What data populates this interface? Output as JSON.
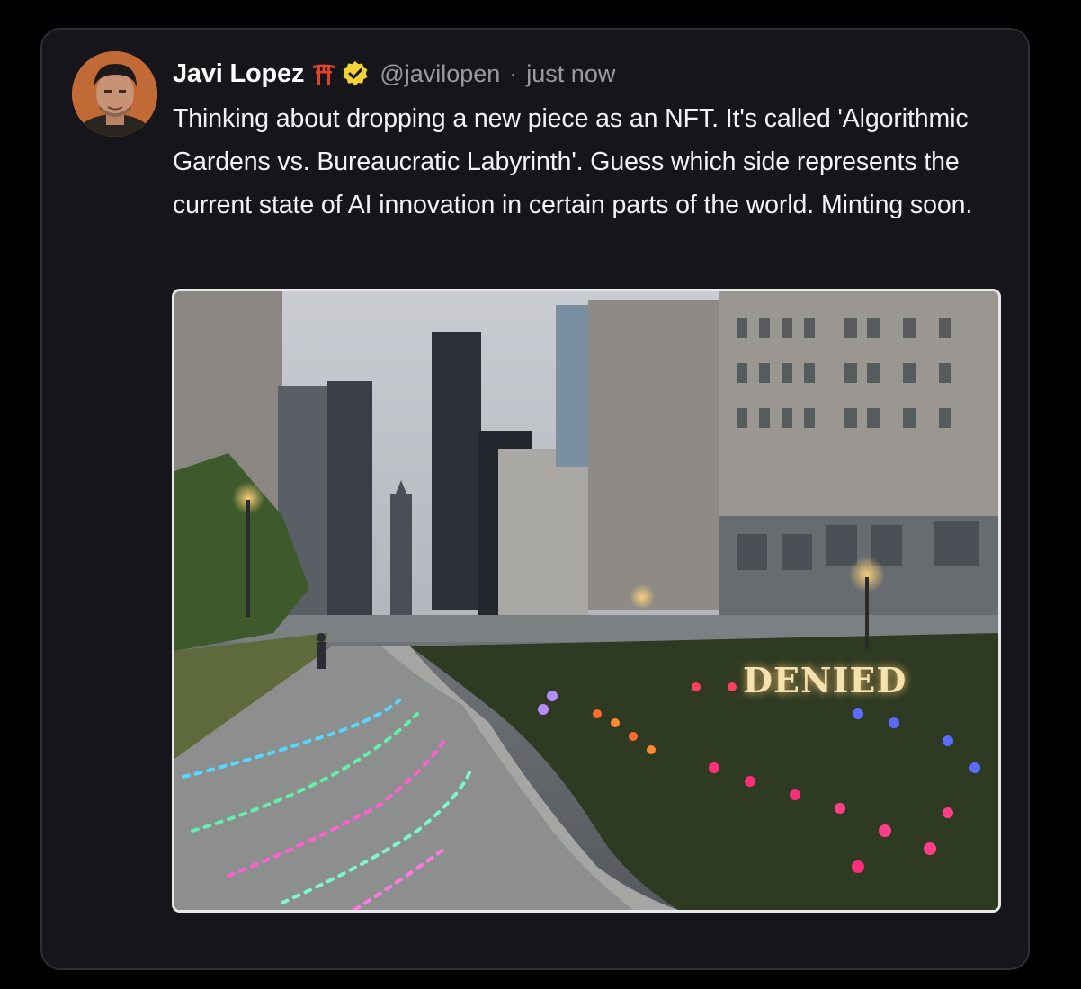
{
  "post": {
    "author": {
      "name": "Javi Lopez",
      "handle": "@javilopen",
      "name_emoji_icon": "torii-gate-icon",
      "verified_icon": "verified-badge-icon"
    },
    "separator": "·",
    "timestamp": "just now",
    "text": "Thinking about dropping a new piece as an NFT. It's called 'Algorithmic Gardens vs. Bureaucratic Labyrinth'. Guess which side represents the current state of AI innovation in certain parts of the world. Minting soon.",
    "media": {
      "sign_text": "DENIED"
    }
  },
  "colors": {
    "background": "#000000",
    "card": "#16161a",
    "card_border": "#2e2e33",
    "text": "#f4f4f6",
    "muted": "#9a9aa0",
    "verified_badge": "#f2d43a",
    "torii": "#e0452b"
  }
}
